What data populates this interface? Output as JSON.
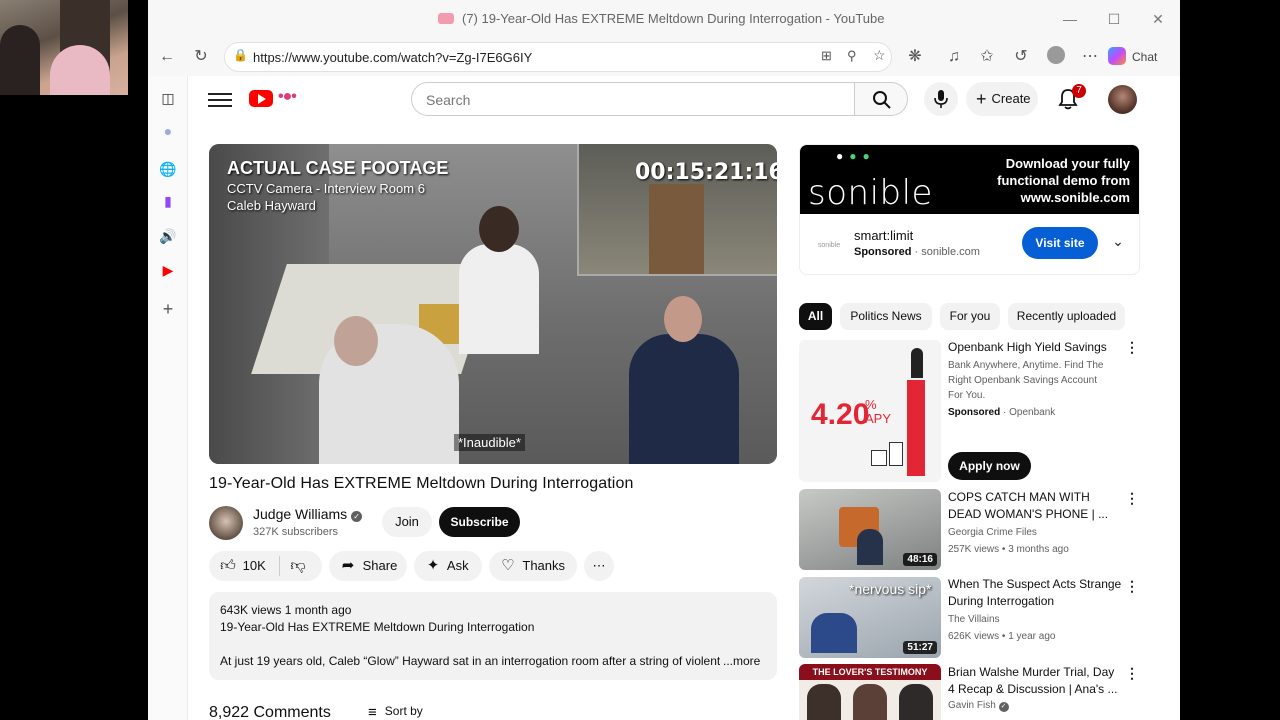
{
  "browser": {
    "tab_title": "(7) 19-Year-Old Has EXTREME Meltdown During Interrogation - YouTube",
    "url": "https://www.youtube.com/watch?v=Zg-I7E6G6IY",
    "chat_label": "Chat"
  },
  "youtube": {
    "search_placeholder": "Search",
    "create_label": "Create",
    "notification_count": "7"
  },
  "video": {
    "overlay_title": "ACTUAL CASE FOOTAGE",
    "overlay_line2": "CCTV Camera - Interview Room 6",
    "overlay_line3": "Caleb Hayward",
    "timestamp": "00:15:21:16",
    "subtitle": "*Inaudible*",
    "title": "19-Year-Old Has EXTREME Meltdown During Interrogation",
    "channel": "Judge Williams",
    "subscribers": "327K subscribers",
    "join_label": "Join",
    "subscribe_label": "Subscribe",
    "likes": "10K",
    "share_label": "Share",
    "ask_label": "Ask",
    "thanks_label": "Thanks",
    "views_date": "643K views  1 month ago",
    "desc_title": "19-Year-Old Has EXTREME Meltdown During Interrogation",
    "desc_body": "At just 19 years old, Caleb “Glow” Hayward sat in an interrogation room after a string of violent",
    "more_label": "...more",
    "comments_count": "8,922 Comments",
    "sort_label": "Sort by"
  },
  "ad": {
    "brand_logo": "sonible",
    "tagline": "Download your fully functional demo from www.sonible.com",
    "product": "smart:limit",
    "sponsored": "Sponsored",
    "domain": "sonible.com",
    "visit_label": "Visit site"
  },
  "chips": [
    "All",
    "Politics News",
    "For you",
    "Recently uploaded"
  ],
  "recommendations": [
    {
      "title": "Openbank High Yield Savings",
      "desc": "Bank Anywhere, Anytime. Find The Right Openbank Savings Account For You.",
      "sponsored": "Sponsored",
      "channel": "Openbank",
      "apy": "4.20",
      "apy_unit": "% APY",
      "apply_label": "Apply now"
    },
    {
      "title": "COPS CATCH MAN WITH DEAD WOMAN'S PHONE | ...",
      "channel": "Georgia Crime Files",
      "views": "257K views • 3 months ago",
      "duration": "48:16"
    },
    {
      "title": "When The Suspect Acts Strange During Interrogation",
      "channel": "The Villains",
      "views": "626K views • 1 year ago",
      "duration": "51:27",
      "thumb_text": "*nervous sip*"
    },
    {
      "title": "Brian Walshe Murder Trial, Day 4 Recap & Discussion | Ana's ...",
      "channel": "Gavin Fish",
      "thumb_text": "THE LOVER'S TESTIMONY"
    }
  ]
}
